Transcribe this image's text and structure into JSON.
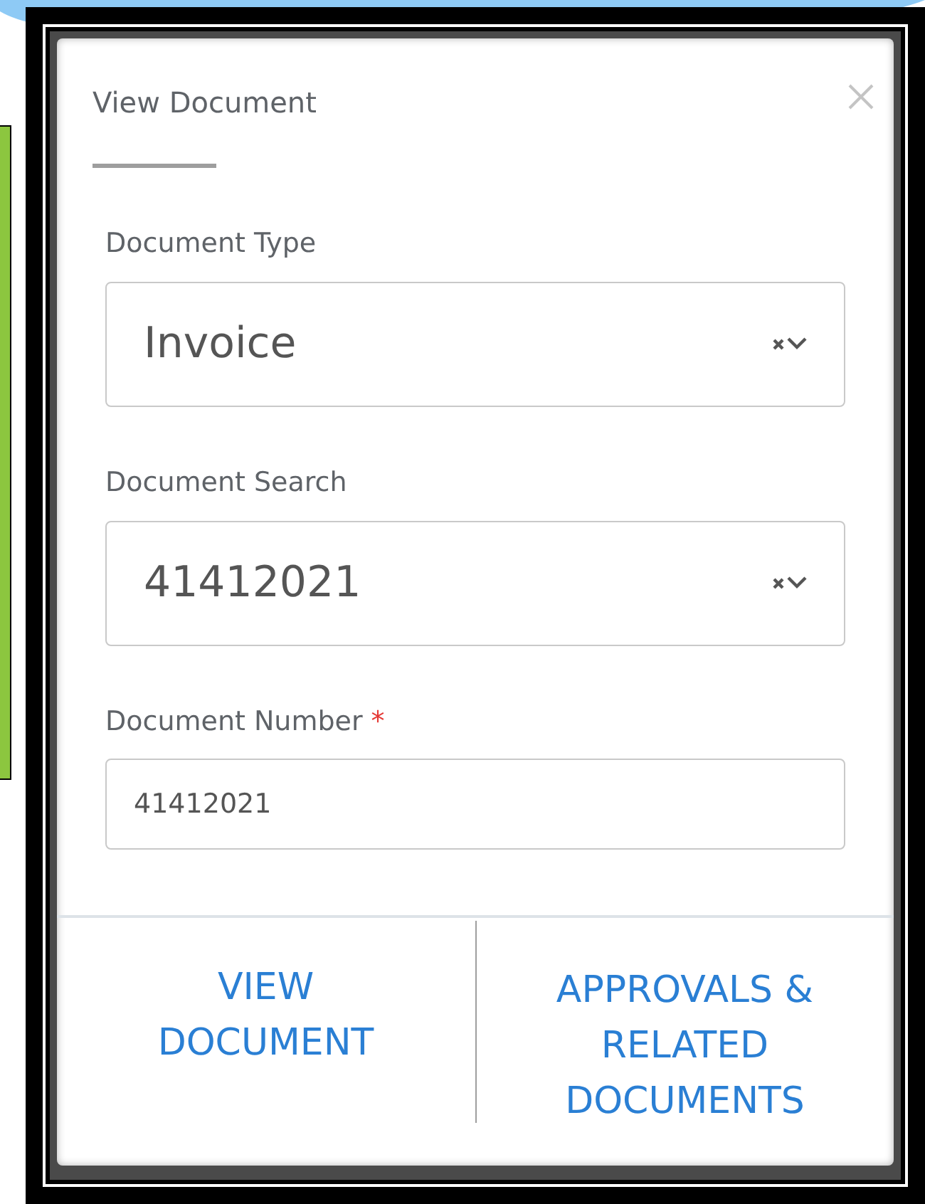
{
  "dialog": {
    "title": "View Document",
    "fields": [
      {
        "kind": "select",
        "label": "Document Type",
        "value": "Invoice"
      },
      {
        "kind": "select",
        "label": "Document Search",
        "value": "41412021"
      },
      {
        "kind": "input",
        "label": "Document Number",
        "required_mark": "*",
        "value": "41412021"
      }
    ],
    "buttons": [
      "VIEW DOCUMENT",
      "APPROVALS & RELATED DOCUMENTS"
    ]
  }
}
